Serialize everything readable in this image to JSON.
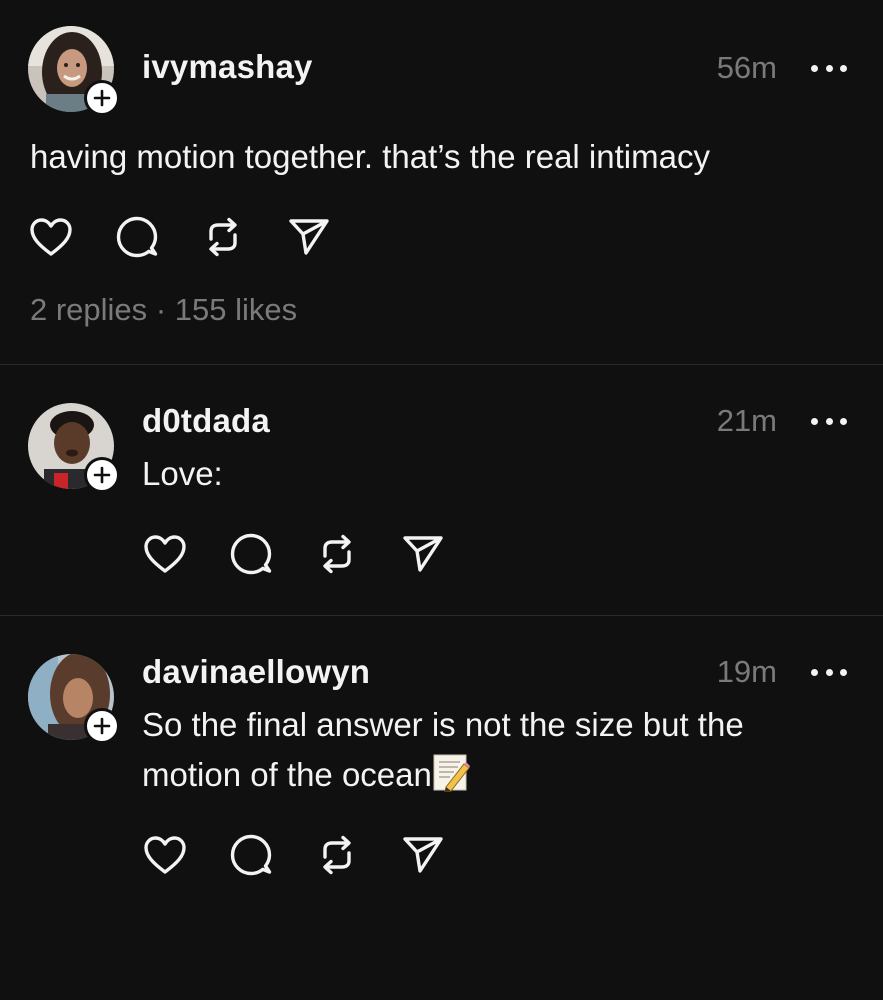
{
  "posts": [
    {
      "username": "ivymashay",
      "time": "56m",
      "text": "having motion together. that’s the real intimacy",
      "stats": {
        "replies": "2 replies",
        "separator": "·",
        "likes": "155 likes"
      }
    },
    {
      "username": "d0tdada",
      "time": "21m",
      "text": "Love:"
    },
    {
      "username": "davinaellowyn",
      "time": "19m",
      "text_line1": "So the final answer is not the size but the",
      "text_line2": "motion of the ocean",
      "emoji": "memo-emoji"
    }
  ],
  "icons": {
    "like": "heart-icon",
    "reply": "comment-icon",
    "repost": "repost-icon",
    "share": "send-icon",
    "more": "more-icon",
    "follow": "plus-icon"
  },
  "colors": {
    "background": "#101010",
    "text": "#f3f3f3",
    "secondary": "#7a7a7a",
    "divider": "#2a2a2a"
  }
}
